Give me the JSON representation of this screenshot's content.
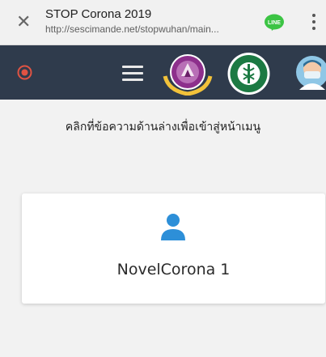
{
  "browser": {
    "close_icon": "close-icon",
    "title": "STOP Corona 2019",
    "url": "http://sescimande.net/stopwuhan/main...",
    "line_badge_text": "LINE",
    "line_badge_color": "#3cc444",
    "menu_icon": "kebab-menu-icon"
  },
  "navbar": {
    "background": "#2f3b4c",
    "record_icon": "record-icon",
    "record_color": "#e05343",
    "menu_icon": "hamburger-menu-icon",
    "logos": [
      "organization-seal-logo",
      "ministry-of-public-health-logo"
    ],
    "avatar_icon": "doctor-avatar-icon"
  },
  "main": {
    "instruction": "คลิกที่ข้อความด้านล่างเพื่อเข้าสู่หน้าเมนู",
    "card": {
      "icon": "user-icon",
      "icon_color": "#2d8fd8",
      "label": "NovelCorona 1"
    }
  }
}
